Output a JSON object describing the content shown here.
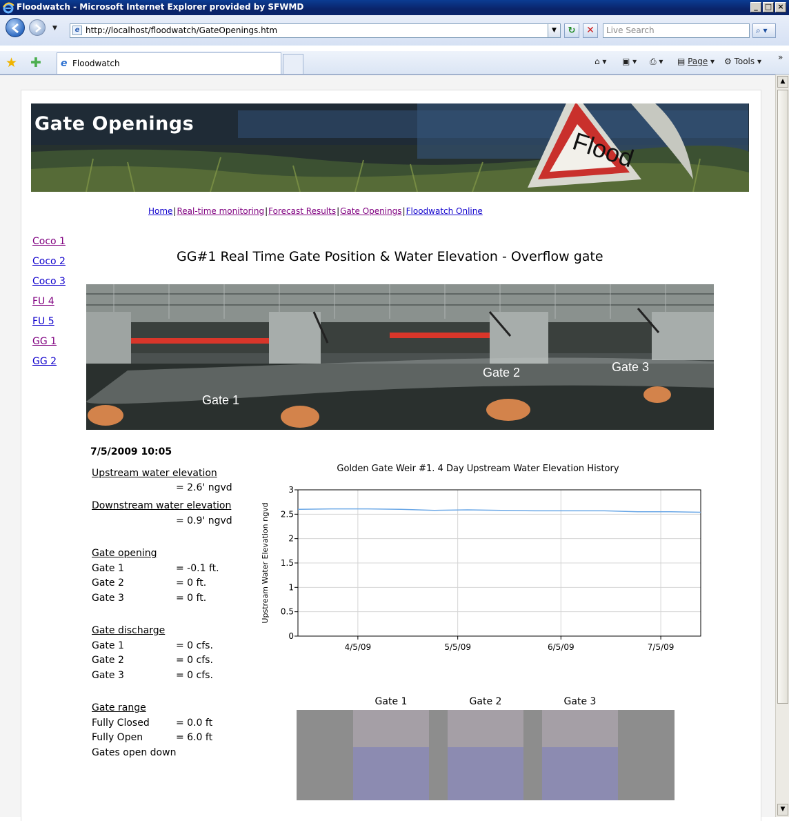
{
  "browser": {
    "title": "Floodwatch - Microsoft Internet Explorer provided by SFWMD",
    "url": "http://localhost/floodwatch/GateOpenings.htm",
    "search_placeholder": "Live Search",
    "tab_label": "Floodwatch",
    "page_menu": "Page",
    "tools_menu": "Tools"
  },
  "banner": {
    "title": "Gate Openings",
    "sign_text": "Flood"
  },
  "nav": {
    "home": "Home",
    "realtime": "Real-time monitoring",
    "forecast": "Forecast Results",
    "gate_openings": "Gate Openings",
    "online": "Floodwatch Online",
    "sep": "|"
  },
  "sidebar": [
    "Coco 1",
    "Coco 2",
    "Coco 3",
    "FU 4",
    "FU 5",
    "GG 1",
    "GG 2"
  ],
  "heading": "GG#1 Real Time Gate Position & Water Elevation - Overflow gate",
  "photo_labels": {
    "gate1": "Gate 1",
    "gate2": "Gate 2",
    "gate3": "Gate 3"
  },
  "readings": {
    "timestamp": "7/5/2009 10:05",
    "upstream_label": "Upstream water elevation",
    "upstream_value": "= 2.6' ngvd",
    "downstream_label": "Downstream water elevation",
    "downstream_value": "= 0.9' ngvd",
    "opening_label": "Gate opening",
    "opening": [
      {
        "gate": "Gate 1",
        "value": "= -0.1 ft."
      },
      {
        "gate": "Gate 2",
        "value": "= 0 ft."
      },
      {
        "gate": "Gate 3",
        "value": "= 0 ft."
      }
    ],
    "discharge_label": "Gate discharge",
    "discharge": [
      {
        "gate": "Gate 1",
        "value": "= 0 cfs."
      },
      {
        "gate": "Gate 2",
        "value": "= 0 cfs."
      },
      {
        "gate": "Gate 3",
        "value": "= 0 cfs."
      }
    ],
    "range_label": "Gate range",
    "range": [
      {
        "label": "Fully Closed",
        "value": "= 0.0 ft"
      },
      {
        "label": "Fully Open",
        "value": "= 6.0 ft"
      }
    ],
    "range_note": "Gates open down"
  },
  "chart_data": {
    "type": "line",
    "title": "Golden Gate Weir #1. 4 Day Upstream Water Elevation History",
    "ylabel": "Upstream Water Elevation ngvd",
    "xlabel": "",
    "ylim": [
      0,
      3
    ],
    "yticks": [
      "0",
      "0.5",
      "1",
      "1.5",
      "2",
      "2.5",
      "3"
    ],
    "xticks": [
      "4/5/09",
      "5/5/09",
      "6/5/09",
      "7/5/09"
    ],
    "xlim": [
      "2009-03-18",
      "2009-07-17"
    ],
    "grid": true,
    "series": [
      {
        "values": [
          [
            "2009-03-18",
            2.6
          ],
          [
            "2009-03-28",
            2.61
          ],
          [
            "2009-04-08",
            2.61
          ],
          [
            "2009-04-18",
            2.6
          ],
          [
            "2009-04-28",
            2.58
          ],
          [
            "2009-05-08",
            2.59
          ],
          [
            "2009-05-18",
            2.58
          ],
          [
            "2009-05-28",
            2.57
          ],
          [
            "2009-06-08",
            2.57
          ],
          [
            "2009-06-18",
            2.57
          ],
          [
            "2009-06-28",
            2.55
          ],
          [
            "2009-07-08",
            2.55
          ],
          [
            "2009-07-17",
            2.54
          ]
        ],
        "color": "#6aa7e6"
      }
    ]
  },
  "gate_diagram": {
    "labels": [
      "Gate 1",
      "Gate 2",
      "Gate 3"
    ],
    "gate_color": "#a59fa6",
    "water_color": "#8c8bb1",
    "frame_color": "#8d8d8d"
  }
}
